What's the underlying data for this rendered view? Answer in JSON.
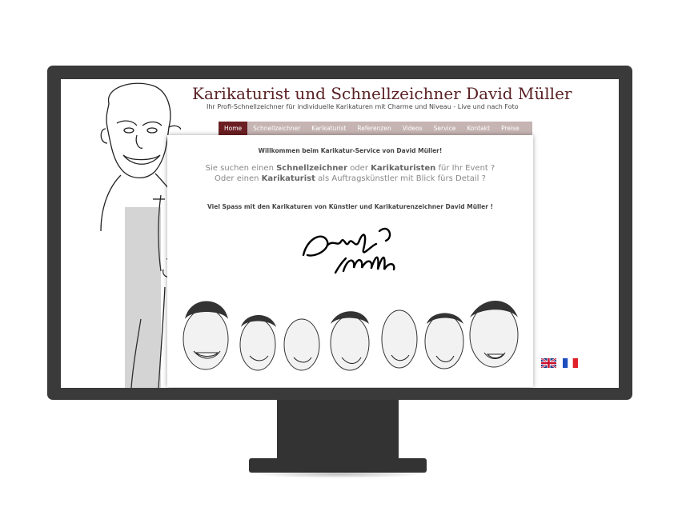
{
  "site": {
    "title": "Karikaturist und Schnellzeichner David Müller",
    "subtitle": "Ihr Profi-Schnellzeichner für individuelle Karikaturen mit Charme und Niveau - Live und nach Foto"
  },
  "nav": {
    "items": [
      "Home",
      "Schnellzeichner",
      "Karikaturist",
      "Referenzen",
      "Videos",
      "Service",
      "Kontakt",
      "Preise"
    ],
    "active": "Home"
  },
  "content": {
    "welcome": "Willkommen beim Karikatur-Service von David Müller!",
    "intro_line1_a": "Sie suchen einen ",
    "intro_line1_b": "Schnellzeichner",
    "intro_line1_c": " oder ",
    "intro_line1_d": "Karikaturisten",
    "intro_line1_e": " für Ihr Event ?",
    "intro_line2_a": "Oder einen ",
    "intro_line2_b": "Karikaturist",
    "intro_line2_c": " als Auftragskünstler mit Blick fürs Detail ?",
    "fun": "Viel Spass mit den Karikaturen von Künstler und Karikaturenzeichner David Müller !"
  },
  "colors": {
    "title": "#5a2124",
    "nav_bg": "#c5b4b2",
    "nav_active": "#6b1f22",
    "monitor": "#3a3a3a"
  },
  "icons": {
    "flag_en": "uk-flag-icon",
    "flag_fr": "france-flag-icon"
  }
}
